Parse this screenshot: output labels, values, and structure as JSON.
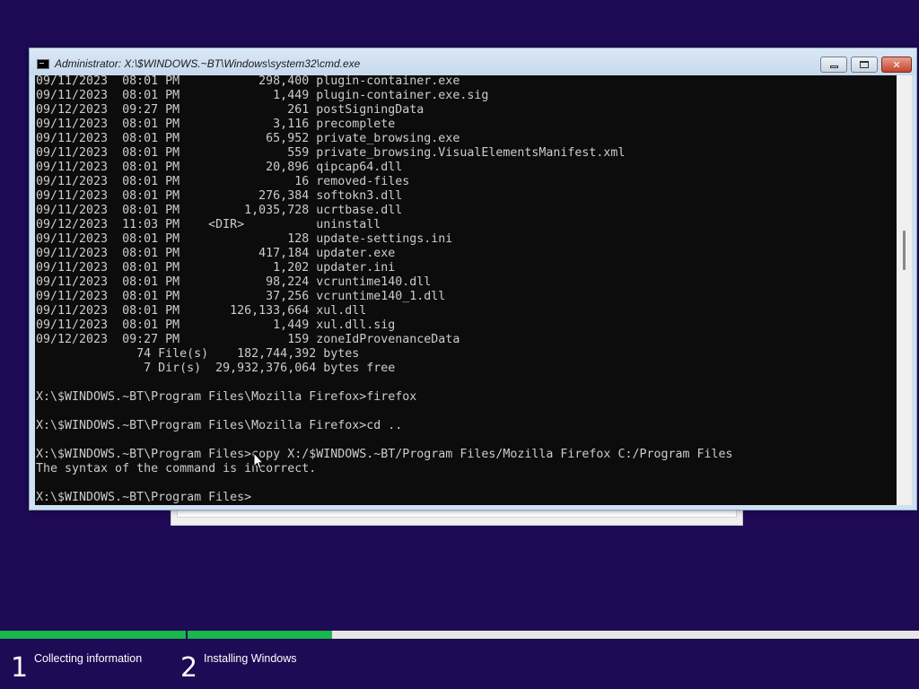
{
  "window": {
    "title": "Administrator: X:\\$WINDOWS.~BT\\Windows\\system32\\cmd.exe",
    "minimize_icon": "minimize-icon",
    "maximize_icon": "restore-icon",
    "close_label": "✕"
  },
  "console": {
    "lines": [
      "09/11/2023  08:01 PM           298,400 plugin-container.exe",
      "09/11/2023  08:01 PM             1,449 plugin-container.exe.sig",
      "09/12/2023  09:27 PM               261 postSigningData",
      "09/11/2023  08:01 PM             3,116 precomplete",
      "09/11/2023  08:01 PM            65,952 private_browsing.exe",
      "09/11/2023  08:01 PM               559 private_browsing.VisualElementsManifest.xml",
      "09/11/2023  08:01 PM            20,896 qipcap64.dll",
      "09/11/2023  08:01 PM                16 removed-files",
      "09/11/2023  08:01 PM           276,384 softokn3.dll",
      "09/11/2023  08:01 PM         1,035,728 ucrtbase.dll",
      "09/12/2023  11:03 PM    <DIR>          uninstall",
      "09/11/2023  08:01 PM               128 update-settings.ini",
      "09/11/2023  08:01 PM           417,184 updater.exe",
      "09/11/2023  08:01 PM             1,202 updater.ini",
      "09/11/2023  08:01 PM            98,224 vcruntime140.dll",
      "09/11/2023  08:01 PM            37,256 vcruntime140_1.dll",
      "09/11/2023  08:01 PM       126,133,664 xul.dll",
      "09/11/2023  08:01 PM             1,449 xul.dll.sig",
      "09/12/2023  09:27 PM               159 zoneIdProvenanceData",
      "              74 File(s)    182,744,392 bytes",
      "               7 Dir(s)  29,932,376,064 bytes free",
      "",
      "X:\\$WINDOWS.~BT\\Program Files\\Mozilla Firefox>firefox",
      "",
      "X:\\$WINDOWS.~BT\\Program Files\\Mozilla Firefox>cd ..",
      "",
      "X:\\$WINDOWS.~BT\\Program Files>copy X:/$WINDOWS.~BT/Program Files/Mozilla Firefox C:/Program Files",
      "The syntax of the command is incorrect.",
      "",
      "X:\\$WINDOWS.~BT\\Program Files>"
    ]
  },
  "setup": {
    "progress": {
      "step1_fraction": 1.0,
      "step2_fraction": 0.197
    },
    "steps": [
      {
        "number": "1",
        "label": "Collecting information"
      },
      {
        "number": "2",
        "label": "Installing Windows"
      }
    ]
  },
  "colors": {
    "desktop_background": "#1f0a55",
    "progress_green": "#19b84a",
    "console_background": "#0c0c0c",
    "console_text": "#cccccc"
  }
}
